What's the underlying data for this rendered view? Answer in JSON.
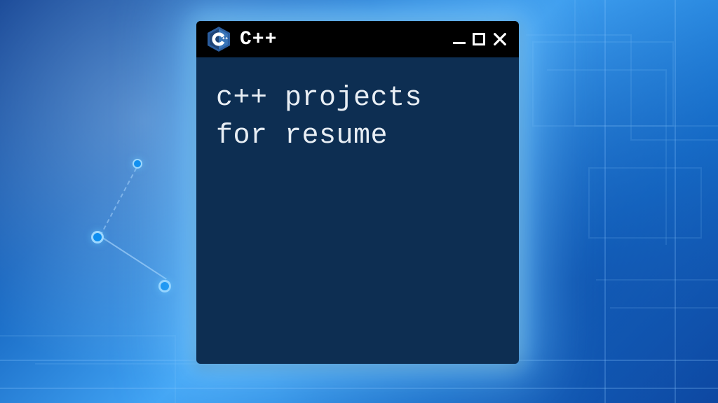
{
  "window": {
    "title": "C++",
    "body_line1": "c++ projects",
    "body_line2": "for resume",
    "icon_name": "cpp-logo-icon"
  },
  "colors": {
    "titlebar_bg": "#000000",
    "body_bg": "#0d2e52",
    "text": "#e8eef4",
    "glow": "#78c8ff"
  }
}
